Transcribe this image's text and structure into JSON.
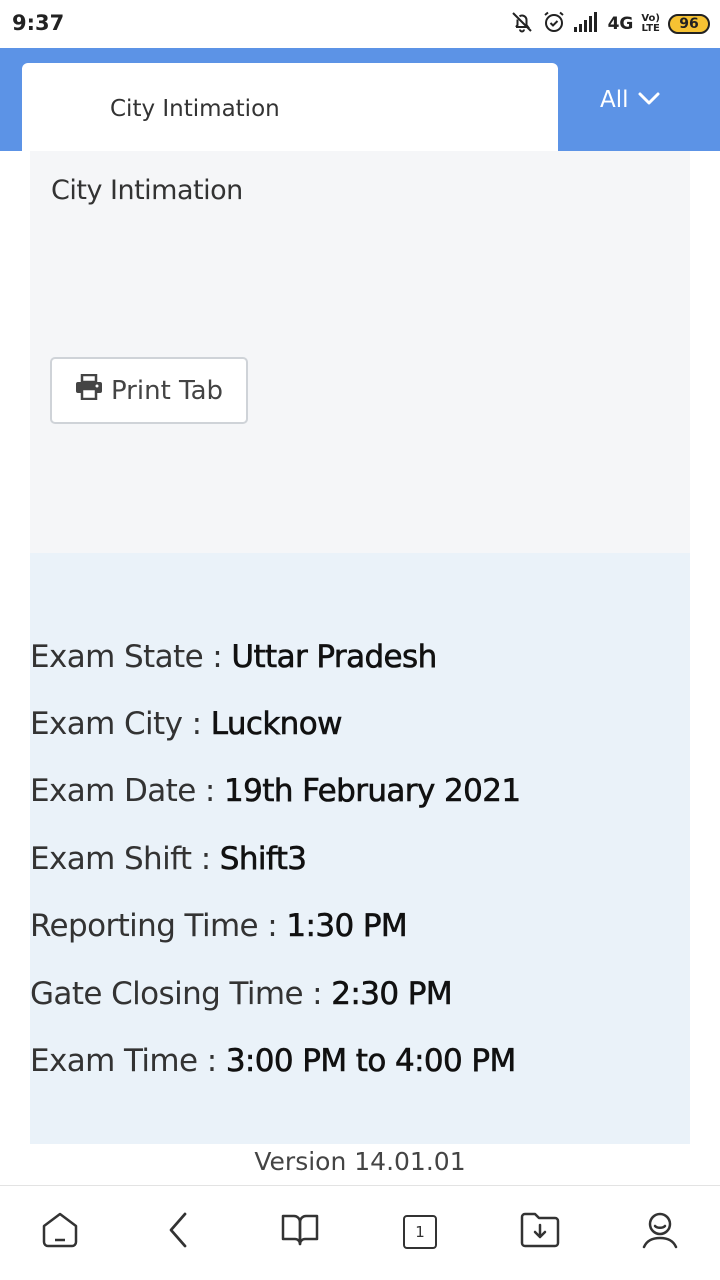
{
  "status_bar": {
    "time": "9:37",
    "network": "4G",
    "volte_top": "Vo)",
    "volte_bottom": "LTE",
    "battery": "96",
    "icons": [
      "bell-off-icon",
      "alarm-icon",
      "signal-icon",
      "battery-icon"
    ]
  },
  "header": {
    "active_tab_label": "City Intimation",
    "dropdown_label": "All",
    "accent_color": "#5c93e6"
  },
  "panel": {
    "title": "City Intimation",
    "print_button_label": "Print Tab"
  },
  "exam_info": [
    {
      "label": "Exam State : ",
      "value": "Uttar Pradesh"
    },
    {
      "label": "Exam City : ",
      "value": "Lucknow"
    },
    {
      "label": "Exam Date : ",
      "value": "19th February 2021"
    },
    {
      "label": "Exam Shift : ",
      "value": "Shift3"
    },
    {
      "label": "Reporting Time : ",
      "value": "1:30 PM"
    },
    {
      "label": "Gate Closing Time : ",
      "value": "2:30 PM"
    },
    {
      "label": "Exam Time : ",
      "value": "3:00 PM to 4:00 PM"
    }
  ],
  "footer": {
    "version": "Version 14.01.01"
  },
  "bottom_nav": {
    "tab_count": "1",
    "icons": [
      "home-icon",
      "back-icon",
      "bookmarks-icon",
      "tabs-icon",
      "downloads-icon",
      "profile-icon"
    ]
  }
}
